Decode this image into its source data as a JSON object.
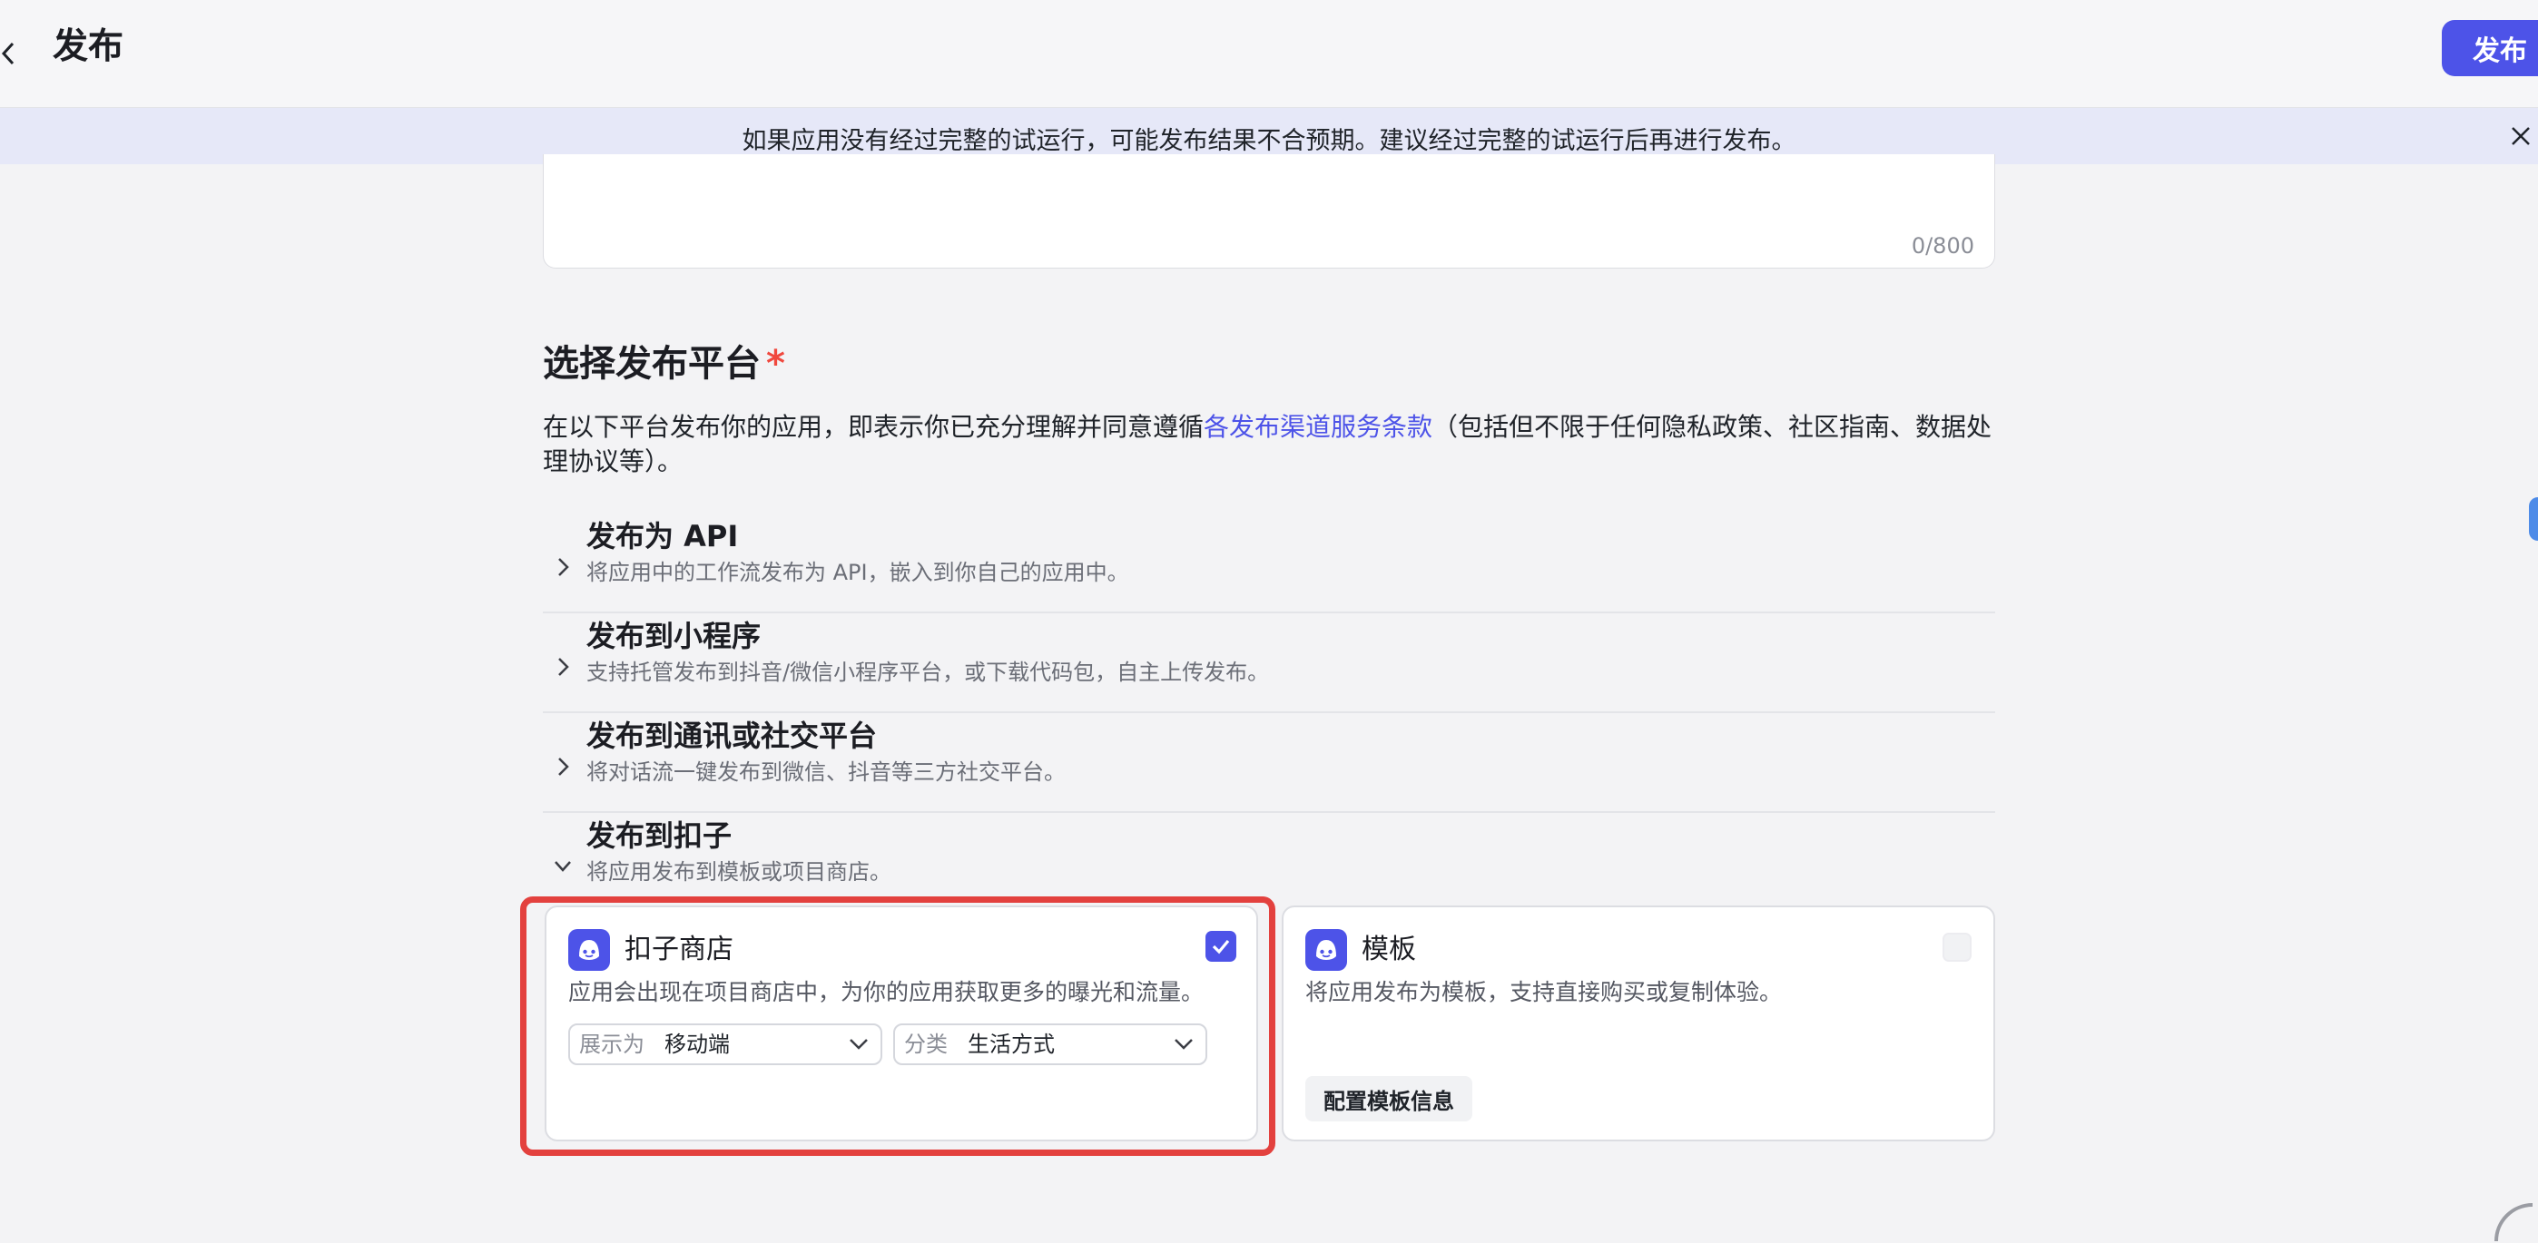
{
  "header": {
    "title": "发布",
    "publish_label": "发布"
  },
  "banner": {
    "text": "如果应用没有经过完整的试运行，可能发布结果不合预期。建议经过完整的试运行后再进行发布。"
  },
  "description": {
    "char_count": "0/800"
  },
  "platform_section": {
    "title": "选择发布平台",
    "required_mark": "*",
    "terms_prefix": "在以下平台发布你的应用，即表示你已充分理解并同意遵循",
    "terms_link": "各发布渠道服务条款",
    "terms_suffix": "（包括但不限于任何隐私政策、社区指南、数据处理协议等）。",
    "rows": [
      {
        "title": "发布为 API",
        "desc": "将应用中的工作流发布为 API，嵌入到你自己的应用中。"
      },
      {
        "title": "发布到小程序",
        "desc": "支持托管发布到抖音/微信小程序平台，或下载代码包，自主上传发布。"
      },
      {
        "title": "发布到通讯或社交平台",
        "desc": "将对话流一键发布到微信、抖音等三方社交平台。"
      },
      {
        "title": "发布到扣子",
        "desc": "将应用发布到模板或项目商店。"
      }
    ]
  },
  "store_card": {
    "title": "扣子商店",
    "desc": "应用会出现在项目商店中，为你的应用获取更多的曝光和流量。",
    "checked": true,
    "display_label": "展示为",
    "display_value": "移动端",
    "category_label": "分类",
    "category_value": "生活方式"
  },
  "template_card": {
    "title": "模板",
    "desc": "将应用发布为模板，支持直接购买或复制体验。",
    "checked": false,
    "config_label": "配置模板信息"
  },
  "colors": {
    "accent": "#4d53e8",
    "highlight": "#e3413e",
    "banner_bg": "#e6e8f8"
  }
}
